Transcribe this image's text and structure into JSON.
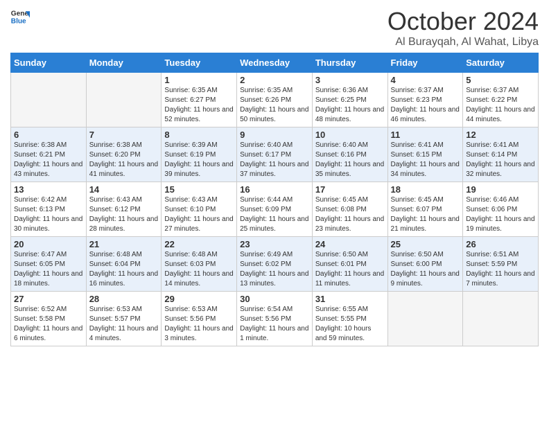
{
  "header": {
    "logo_line1": "General",
    "logo_line2": "Blue",
    "month": "October 2024",
    "location": "Al Burayqah, Al Wahat, Libya"
  },
  "weekdays": [
    "Sunday",
    "Monday",
    "Tuesday",
    "Wednesday",
    "Thursday",
    "Friday",
    "Saturday"
  ],
  "weeks": [
    [
      {
        "day": "",
        "empty": true
      },
      {
        "day": "",
        "empty": true
      },
      {
        "day": "1",
        "sunrise": "6:35 AM",
        "sunset": "6:27 PM",
        "daylight": "11 hours and 52 minutes."
      },
      {
        "day": "2",
        "sunrise": "6:35 AM",
        "sunset": "6:26 PM",
        "daylight": "11 hours and 50 minutes."
      },
      {
        "day": "3",
        "sunrise": "6:36 AM",
        "sunset": "6:25 PM",
        "daylight": "11 hours and 48 minutes."
      },
      {
        "day": "4",
        "sunrise": "6:37 AM",
        "sunset": "6:23 PM",
        "daylight": "11 hours and 46 minutes."
      },
      {
        "day": "5",
        "sunrise": "6:37 AM",
        "sunset": "6:22 PM",
        "daylight": "11 hours and 44 minutes."
      }
    ],
    [
      {
        "day": "6",
        "sunrise": "6:38 AM",
        "sunset": "6:21 PM",
        "daylight": "11 hours and 43 minutes."
      },
      {
        "day": "7",
        "sunrise": "6:38 AM",
        "sunset": "6:20 PM",
        "daylight": "11 hours and 41 minutes."
      },
      {
        "day": "8",
        "sunrise": "6:39 AM",
        "sunset": "6:19 PM",
        "daylight": "11 hours and 39 minutes."
      },
      {
        "day": "9",
        "sunrise": "6:40 AM",
        "sunset": "6:17 PM",
        "daylight": "11 hours and 37 minutes."
      },
      {
        "day": "10",
        "sunrise": "6:40 AM",
        "sunset": "6:16 PM",
        "daylight": "11 hours and 35 minutes."
      },
      {
        "day": "11",
        "sunrise": "6:41 AM",
        "sunset": "6:15 PM",
        "daylight": "11 hours and 34 minutes."
      },
      {
        "day": "12",
        "sunrise": "6:41 AM",
        "sunset": "6:14 PM",
        "daylight": "11 hours and 32 minutes."
      }
    ],
    [
      {
        "day": "13",
        "sunrise": "6:42 AM",
        "sunset": "6:13 PM",
        "daylight": "11 hours and 30 minutes."
      },
      {
        "day": "14",
        "sunrise": "6:43 AM",
        "sunset": "6:12 PM",
        "daylight": "11 hours and 28 minutes."
      },
      {
        "day": "15",
        "sunrise": "6:43 AM",
        "sunset": "6:10 PM",
        "daylight": "11 hours and 27 minutes."
      },
      {
        "day": "16",
        "sunrise": "6:44 AM",
        "sunset": "6:09 PM",
        "daylight": "11 hours and 25 minutes."
      },
      {
        "day": "17",
        "sunrise": "6:45 AM",
        "sunset": "6:08 PM",
        "daylight": "11 hours and 23 minutes."
      },
      {
        "day": "18",
        "sunrise": "6:45 AM",
        "sunset": "6:07 PM",
        "daylight": "11 hours and 21 minutes."
      },
      {
        "day": "19",
        "sunrise": "6:46 AM",
        "sunset": "6:06 PM",
        "daylight": "11 hours and 19 minutes."
      }
    ],
    [
      {
        "day": "20",
        "sunrise": "6:47 AM",
        "sunset": "6:05 PM",
        "daylight": "11 hours and 18 minutes."
      },
      {
        "day": "21",
        "sunrise": "6:48 AM",
        "sunset": "6:04 PM",
        "daylight": "11 hours and 16 minutes."
      },
      {
        "day": "22",
        "sunrise": "6:48 AM",
        "sunset": "6:03 PM",
        "daylight": "11 hours and 14 minutes."
      },
      {
        "day": "23",
        "sunrise": "6:49 AM",
        "sunset": "6:02 PM",
        "daylight": "11 hours and 13 minutes."
      },
      {
        "day": "24",
        "sunrise": "6:50 AM",
        "sunset": "6:01 PM",
        "daylight": "11 hours and 11 minutes."
      },
      {
        "day": "25",
        "sunrise": "6:50 AM",
        "sunset": "6:00 PM",
        "daylight": "11 hours and 9 minutes."
      },
      {
        "day": "26",
        "sunrise": "6:51 AM",
        "sunset": "5:59 PM",
        "daylight": "11 hours and 7 minutes."
      }
    ],
    [
      {
        "day": "27",
        "sunrise": "6:52 AM",
        "sunset": "5:58 PM",
        "daylight": "11 hours and 6 minutes."
      },
      {
        "day": "28",
        "sunrise": "6:53 AM",
        "sunset": "5:57 PM",
        "daylight": "11 hours and 4 minutes."
      },
      {
        "day": "29",
        "sunrise": "6:53 AM",
        "sunset": "5:56 PM",
        "daylight": "11 hours and 3 minutes."
      },
      {
        "day": "30",
        "sunrise": "6:54 AM",
        "sunset": "5:56 PM",
        "daylight": "11 hours and 1 minute."
      },
      {
        "day": "31",
        "sunrise": "6:55 AM",
        "sunset": "5:55 PM",
        "daylight": "10 hours and 59 minutes."
      },
      {
        "day": "",
        "empty": true
      },
      {
        "day": "",
        "empty": true
      }
    ]
  ]
}
